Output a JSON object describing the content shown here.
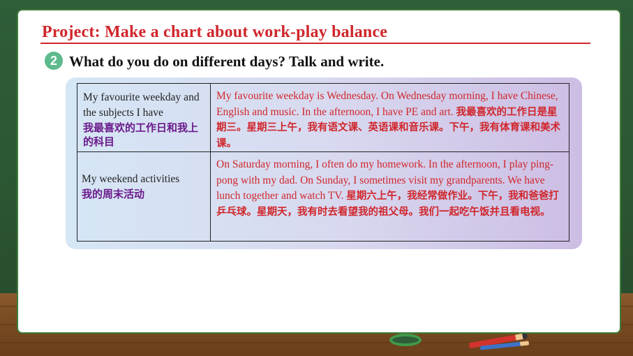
{
  "slide": {
    "project_title": "Project: Make a chart about work-play balance",
    "step_number": "2",
    "step_instruction": "What do you do on different days? Talk and write."
  },
  "table": {
    "rows": [
      {
        "label_en": "My favourite weekday and the subjects I have",
        "label_cn": "我最喜欢的工作日和我上的科目",
        "content_en": "My favourite weekday is Wednesday. On Wednesday morning, I have Chinese, English and music. In the afternoon, I have PE and art. ",
        "content_cn": "我最喜欢的工作日是星期三。星期三上午，我有语文课、英语课和音乐课。下午，我有体育课和美术课。"
      },
      {
        "label_en": "My weekend activities",
        "label_cn": "我的周末活动",
        "content_en": "On Saturday morning, I often do my homework. In the afternoon, I play ping-pong with my dad. On Sunday, I sometimes visit my grandparents. We have lunch together and watch TV. ",
        "content_cn": "星期六上午，我经常做作业。下午，我和爸爸打乒乓球。星期天，我有时去看望我的祖父母。我们一起吃午饭并且看电视。"
      }
    ]
  },
  "colors": {
    "title_red": "#d0262b",
    "badge_green": "#5dba8c",
    "label_purple": "#6b1a8c",
    "board_green": "#2f5d38"
  }
}
